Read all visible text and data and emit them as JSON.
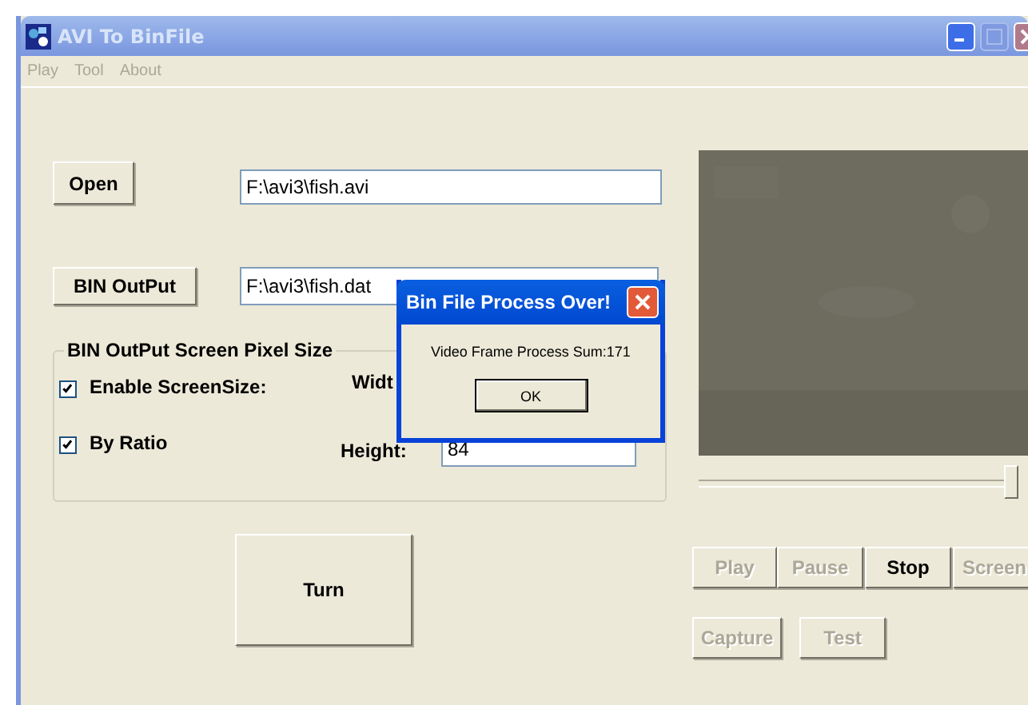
{
  "window": {
    "title": "AVI To BinFile",
    "active": false
  },
  "menu": [
    {
      "label": "Play",
      "disabled": true
    },
    {
      "label": "Tool",
      "disabled": true
    },
    {
      "label": "About",
      "disabled": true
    }
  ],
  "open_button": "Open",
  "open_path": "F:\\avi3\\fish.avi",
  "output_button": "BIN OutPut",
  "output_path": "F:\\avi3\\fish.dat",
  "group": {
    "title": "BIN OutPut Screen Pixel Size",
    "checkboxes": [
      {
        "label": "Enable ScreenSize:",
        "checked": true
      },
      {
        "label": "By Ratio",
        "checked": true
      }
    ],
    "width_label": "Widt",
    "height_label": "Height:",
    "height_value": "84"
  },
  "turn_button": "Turn",
  "slider": {
    "level": 1
  },
  "player_buttons": [
    {
      "label": "Play",
      "disabled": true
    },
    {
      "label": "Pause",
      "disabled": true
    },
    {
      "label": "Stop",
      "disabled": false
    },
    {
      "label": "Screen",
      "disabled": true
    }
  ],
  "tool_buttons": [
    {
      "label": "Capture",
      "disabled": true
    },
    {
      "label": "Test",
      "disabled": true
    }
  ],
  "dialog": {
    "title": "Bin File Process Over!",
    "message": "Video Frame Process Sum:171",
    "button": "OK"
  }
}
